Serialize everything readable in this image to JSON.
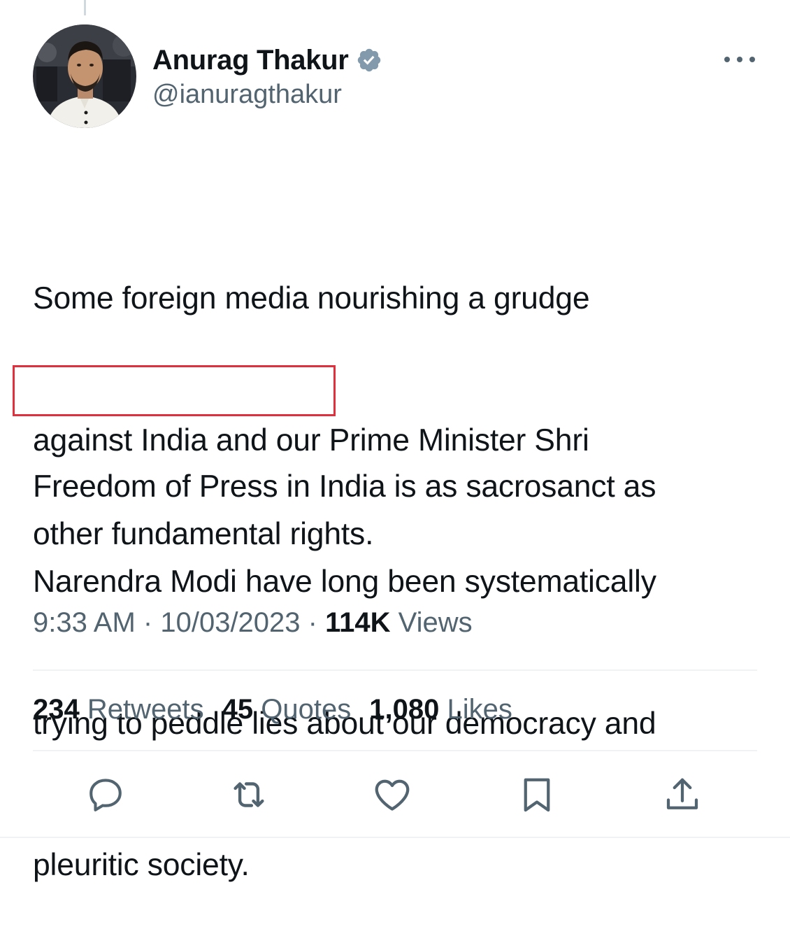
{
  "author": {
    "display_name": "Anurag Thakur",
    "handle": "@ianuragthakur",
    "verified": true
  },
  "tweet": {
    "text_lines": [
      "Some foreign media nourishing a grudge",
      "against India and our Prime Minister Shri",
      "Narendra Modi have long been systematically",
      "trying to peddle lies about our democracy and",
      "pleuritic society."
    ],
    "paragraph2_lines": [
      "Freedom of Press in India is as sacrosanct as",
      "other fundamental rights."
    ],
    "highlight_color": "#e0303d"
  },
  "meta": {
    "time": "9:33 AM",
    "date": "10/03/2023",
    "views_count": "114K",
    "views_label": "Views",
    "separator": "·"
  },
  "stats": {
    "retweets": {
      "count": "234",
      "label": "Retweets"
    },
    "quotes": {
      "count": "45",
      "label": "Quotes"
    },
    "likes": {
      "count": "1,080",
      "label": "Likes"
    }
  },
  "actions": [
    {
      "name": "reply-icon"
    },
    {
      "name": "retweet-icon"
    },
    {
      "name": "like-icon"
    },
    {
      "name": "bookmark-icon"
    },
    {
      "name": "share-icon"
    }
  ],
  "colors": {
    "text_primary": "#0f1419",
    "text_secondary": "#536471",
    "verified_badge": "#829aab",
    "divider": "#eff3f4"
  }
}
